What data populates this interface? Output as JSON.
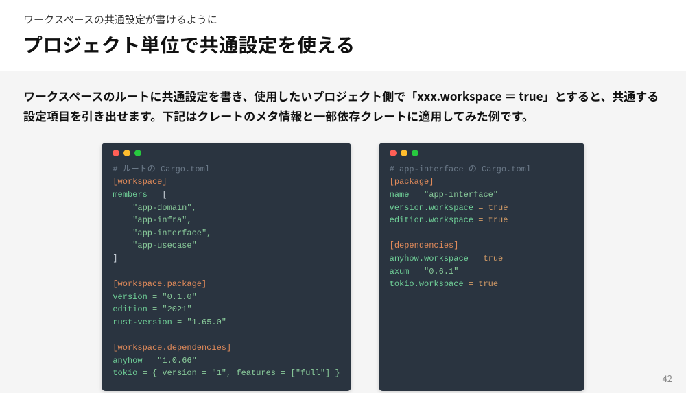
{
  "header": {
    "subtitle": "ワークスペースの共通設定が書けるように",
    "title": "プロジェクト単位で共通設定を使える"
  },
  "lead": "ワークスペースのルートに共通設定を書き、使用したいプロジェクト側で「xxx.workspace ＝ true」とすると、共通する設定項目を引き出せます。下記はクレートのメタ情報と一部依存クレートに適用してみた例です。",
  "code_left": {
    "comment": "# ルートの Cargo.toml",
    "sec1": "[workspace]",
    "members_key": "members",
    "members_open": " = [",
    "m1": "    \"app-domain\",",
    "m2": "    \"app-infra\",",
    "m3": "    \"app-interface\",",
    "m4": "    \"app-usecase\"",
    "members_close": "]",
    "sec2": "[workspace.package]",
    "version_k": "version",
    "version_v": " = \"0.1.0\"",
    "edition_k": "edition",
    "edition_v": " = \"2021\"",
    "rustv_k": "rust-version",
    "rustv_v": " = \"1.65.0\"",
    "sec3": "[workspace.dependencies]",
    "anyhow_k": "anyhow",
    "anyhow_v": " = \"1.0.66\"",
    "tokio_k": "tokio",
    "tokio_v": " = { version = \"1\", features = [\"full\"] }"
  },
  "code_right": {
    "comment": "# app-interface の Cargo.toml",
    "sec1": "[package]",
    "name_k": "name",
    "name_v": " = \"app-interface\"",
    "vw_k": "version.workspace",
    "vw_v": " = true",
    "ew_k": "edition.workspace",
    "ew_v": " = true",
    "sec2": "[dependencies]",
    "anyhow_k": "anyhow.workspace",
    "anyhow_v": " = true",
    "axum_k": "axum",
    "axum_v": " = \"0.6.1\"",
    "tokio_k": "tokio.workspace",
    "tokio_v": " = true"
  },
  "page_number": "42"
}
